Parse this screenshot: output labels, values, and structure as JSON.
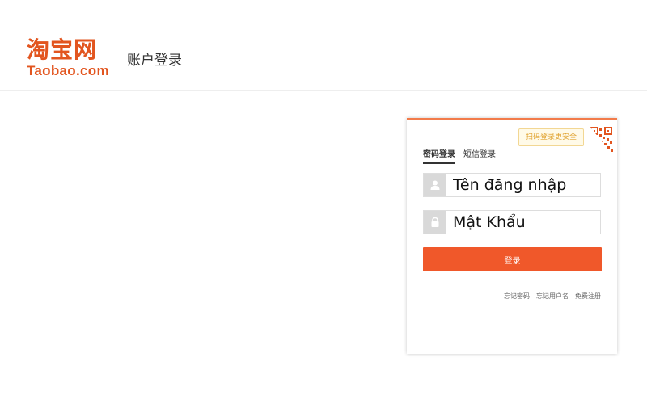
{
  "header": {
    "logo_cn": "淘宝网",
    "logo_en": "Taobao.com",
    "page_title": "账户登录"
  },
  "login": {
    "qr_tip": "扫码登录更安全",
    "tabs": [
      {
        "label": "密码登录",
        "active": true
      },
      {
        "label": "短信登录",
        "active": false
      }
    ],
    "username_placeholder": "Tên đăng nhập",
    "password_placeholder": "Mật Khẩu",
    "submit_label": "登录",
    "links": [
      "忘记密码",
      "忘记用户名",
      "免费注册"
    ]
  },
  "icons": {
    "username": "user-icon",
    "password": "lock-icon",
    "qr": "qr-code-icon"
  },
  "colors": {
    "brand": "#e2551f",
    "button": "#f0582a",
    "box_top_border": "#f27b4a"
  }
}
